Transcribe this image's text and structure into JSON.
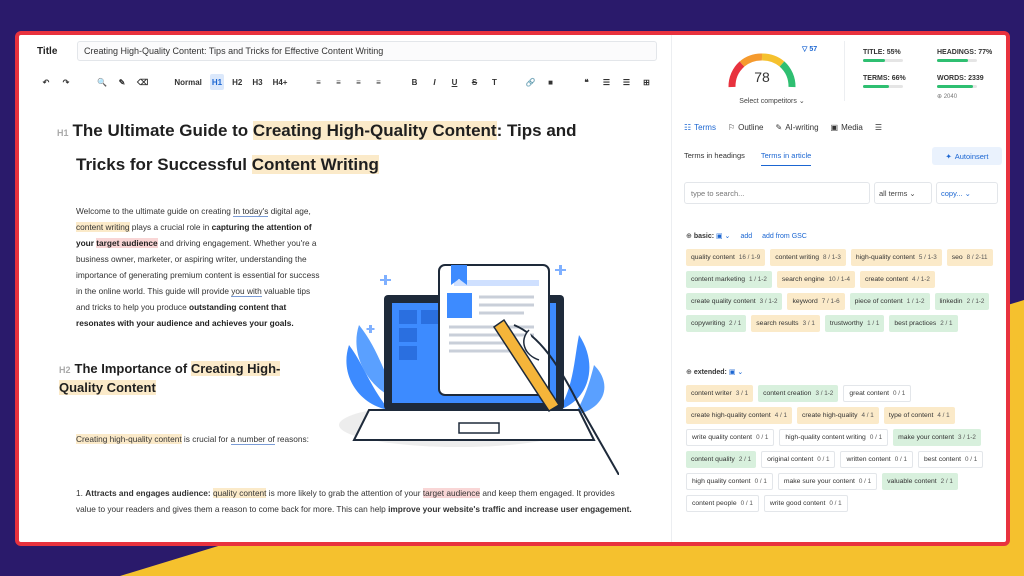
{
  "editor": {
    "title_label": "Title",
    "title_value": "Creating High-Quality Content: Tips and Tricks for Effective Content Writing",
    "toolbar": [
      "↶",
      "↷",
      "🔍",
      "✎",
      "⌫",
      "Normal",
      "H1",
      "H2",
      "H3",
      "H4+",
      "≡",
      "≡",
      "≡",
      "≡",
      "B",
      "I",
      "U",
      "S",
      "T",
      "🔗",
      "■",
      "❝",
      "☰",
      "☰",
      "⊞"
    ],
    "h1_mark": "H1",
    "h1_a": "The Ultimate Guide to ",
    "h1_b": "Creating High-Quality Content",
    "h1_c": ": Tips and",
    "h1_d": "Tricks for Successful ",
    "h1_e": "Content Writing",
    "intro": {
      "a": "Welcome to the ultimate guide on creating  ",
      "b": "In today's",
      "c": " digital age, ",
      "d": "content writing",
      "e": " plays a crucial role in ",
      "f": "capturing the attention of your ",
      "g": "target audience",
      "h": " and driving engagement. Whether you're a business owner, marketer, or aspiring writer, understanding the importance of generating premium content is essential for success in the online world. This guide will provide ",
      "i": "you with",
      "j": " valuable tips and tricks to help you produce ",
      "k": "outstanding content that resonates with your audience and achieves your goals."
    },
    "h2_mark": "H2",
    "h2_a": "The Importance of ",
    "h2_b": "Creating High-Quality Content",
    "p2_a": "Creating high-quality content",
    "p2_b": " is crucial for ",
    "p2_c": "a number of",
    "p2_d": " reasons:",
    "p3_a": "1. ",
    "p3_b": "Attracts and engages audience:",
    "p3_c": " ",
    "p3_d": "quality content",
    "p3_e": " is more likely to grab the attention of your ",
    "p3_f": "target audience",
    "p3_g": " and keep them engaged. It provides value to your readers and gives them a reason to come back for more. This can help ",
    "p3_h": "improve your website's traffic and increase user engagement."
  },
  "panel": {
    "score": "78",
    "competitors_count": "57",
    "select_competitors": "Select competitors ⌄",
    "stats": {
      "title": "TITLE: 55%",
      "title_pct": 0.55,
      "headings": "HEADINGS: 77%",
      "headings_pct": 0.77,
      "terms": "TERMS: 66%",
      "terms_pct": 0.66,
      "words": "WORDS: 2339",
      "words_pct": 0.9,
      "words_target": "⊕ 2040"
    },
    "tabs": [
      "Terms",
      "Outline",
      "AI-writing",
      "Media"
    ],
    "subtabs": [
      "Terms in headings",
      "Terms in article"
    ],
    "autoinsert": "Autoinsert",
    "search_placeholder": "type to search...",
    "filter": "all terms  ⌄",
    "copy": "copy...  ⌄",
    "basic_label": "basic:",
    "extended_label": "extended:",
    "add": "add",
    "add_gsc": "add from GSC",
    "basic_terms": [
      {
        "t": "quality content",
        "n": "16 / 1-9",
        "c": "y"
      },
      {
        "t": "content writing",
        "n": "8 / 1-3",
        "c": "y"
      },
      {
        "t": "high-quality content",
        "n": "5 / 1-3",
        "c": "y"
      },
      {
        "t": "seo",
        "n": "8 / 2-11",
        "c": "y"
      },
      {
        "t": "content marketing",
        "n": "1 / 1-2",
        "c": "g"
      },
      {
        "t": "search engine",
        "n": "10 / 1-4",
        "c": "y"
      },
      {
        "t": "create content",
        "n": "4 / 1-2",
        "c": "y"
      },
      {
        "t": "create quality content",
        "n": "3 / 1-2",
        "c": "g"
      },
      {
        "t": "keyword",
        "n": "7 / 1-6",
        "c": "y"
      },
      {
        "t": "piece of content",
        "n": "1 / 1-2",
        "c": "g"
      },
      {
        "t": "linkedin",
        "n": "2 / 1-2",
        "c": "g"
      },
      {
        "t": "copywriting",
        "n": "2 / 1",
        "c": "g"
      },
      {
        "t": "search results",
        "n": "3 / 1",
        "c": "y"
      },
      {
        "t": "trustworthy",
        "n": "1 / 1",
        "c": "g"
      },
      {
        "t": "best practices",
        "n": "2 / 1",
        "c": "g"
      }
    ],
    "extended_terms": [
      {
        "t": "content writer",
        "n": "3 / 1",
        "c": "y"
      },
      {
        "t": "content creation",
        "n": "3 / 1-2",
        "c": "g"
      },
      {
        "t": "great content",
        "n": "0 / 1",
        "c": "w"
      },
      {
        "t": "create high-quality content",
        "n": "4 / 1",
        "c": "y"
      },
      {
        "t": "create high-quality",
        "n": "4 / 1",
        "c": "y"
      },
      {
        "t": "type of content",
        "n": "4 / 1",
        "c": "y"
      },
      {
        "t": "write quality content",
        "n": "0 / 1",
        "c": "w"
      },
      {
        "t": "high-quality content writing",
        "n": "0 / 1",
        "c": "w"
      },
      {
        "t": "make your content",
        "n": "3 / 1-2",
        "c": "g"
      },
      {
        "t": "content quality",
        "n": "2 / 1",
        "c": "g"
      },
      {
        "t": "original content",
        "n": "0 / 1",
        "c": "w"
      },
      {
        "t": "written content",
        "n": "0 / 1",
        "c": "w"
      },
      {
        "t": "best content",
        "n": "0 / 1",
        "c": "w"
      },
      {
        "t": "high quality content",
        "n": "0 / 1",
        "c": "w"
      },
      {
        "t": "make sure your content",
        "n": "0 / 1",
        "c": "w"
      },
      {
        "t": "valuable content",
        "n": "2 / 1",
        "c": "g"
      },
      {
        "t": "content people",
        "n": "0 / 1",
        "c": "w"
      },
      {
        "t": "write good content",
        "n": "0 / 1",
        "c": "w"
      }
    ]
  },
  "colors": {
    "frame": "#e8323e",
    "accent": "#1b66d2",
    "bg_purple": "#2a1a6b",
    "bg_yellow": "#f5c12e"
  }
}
